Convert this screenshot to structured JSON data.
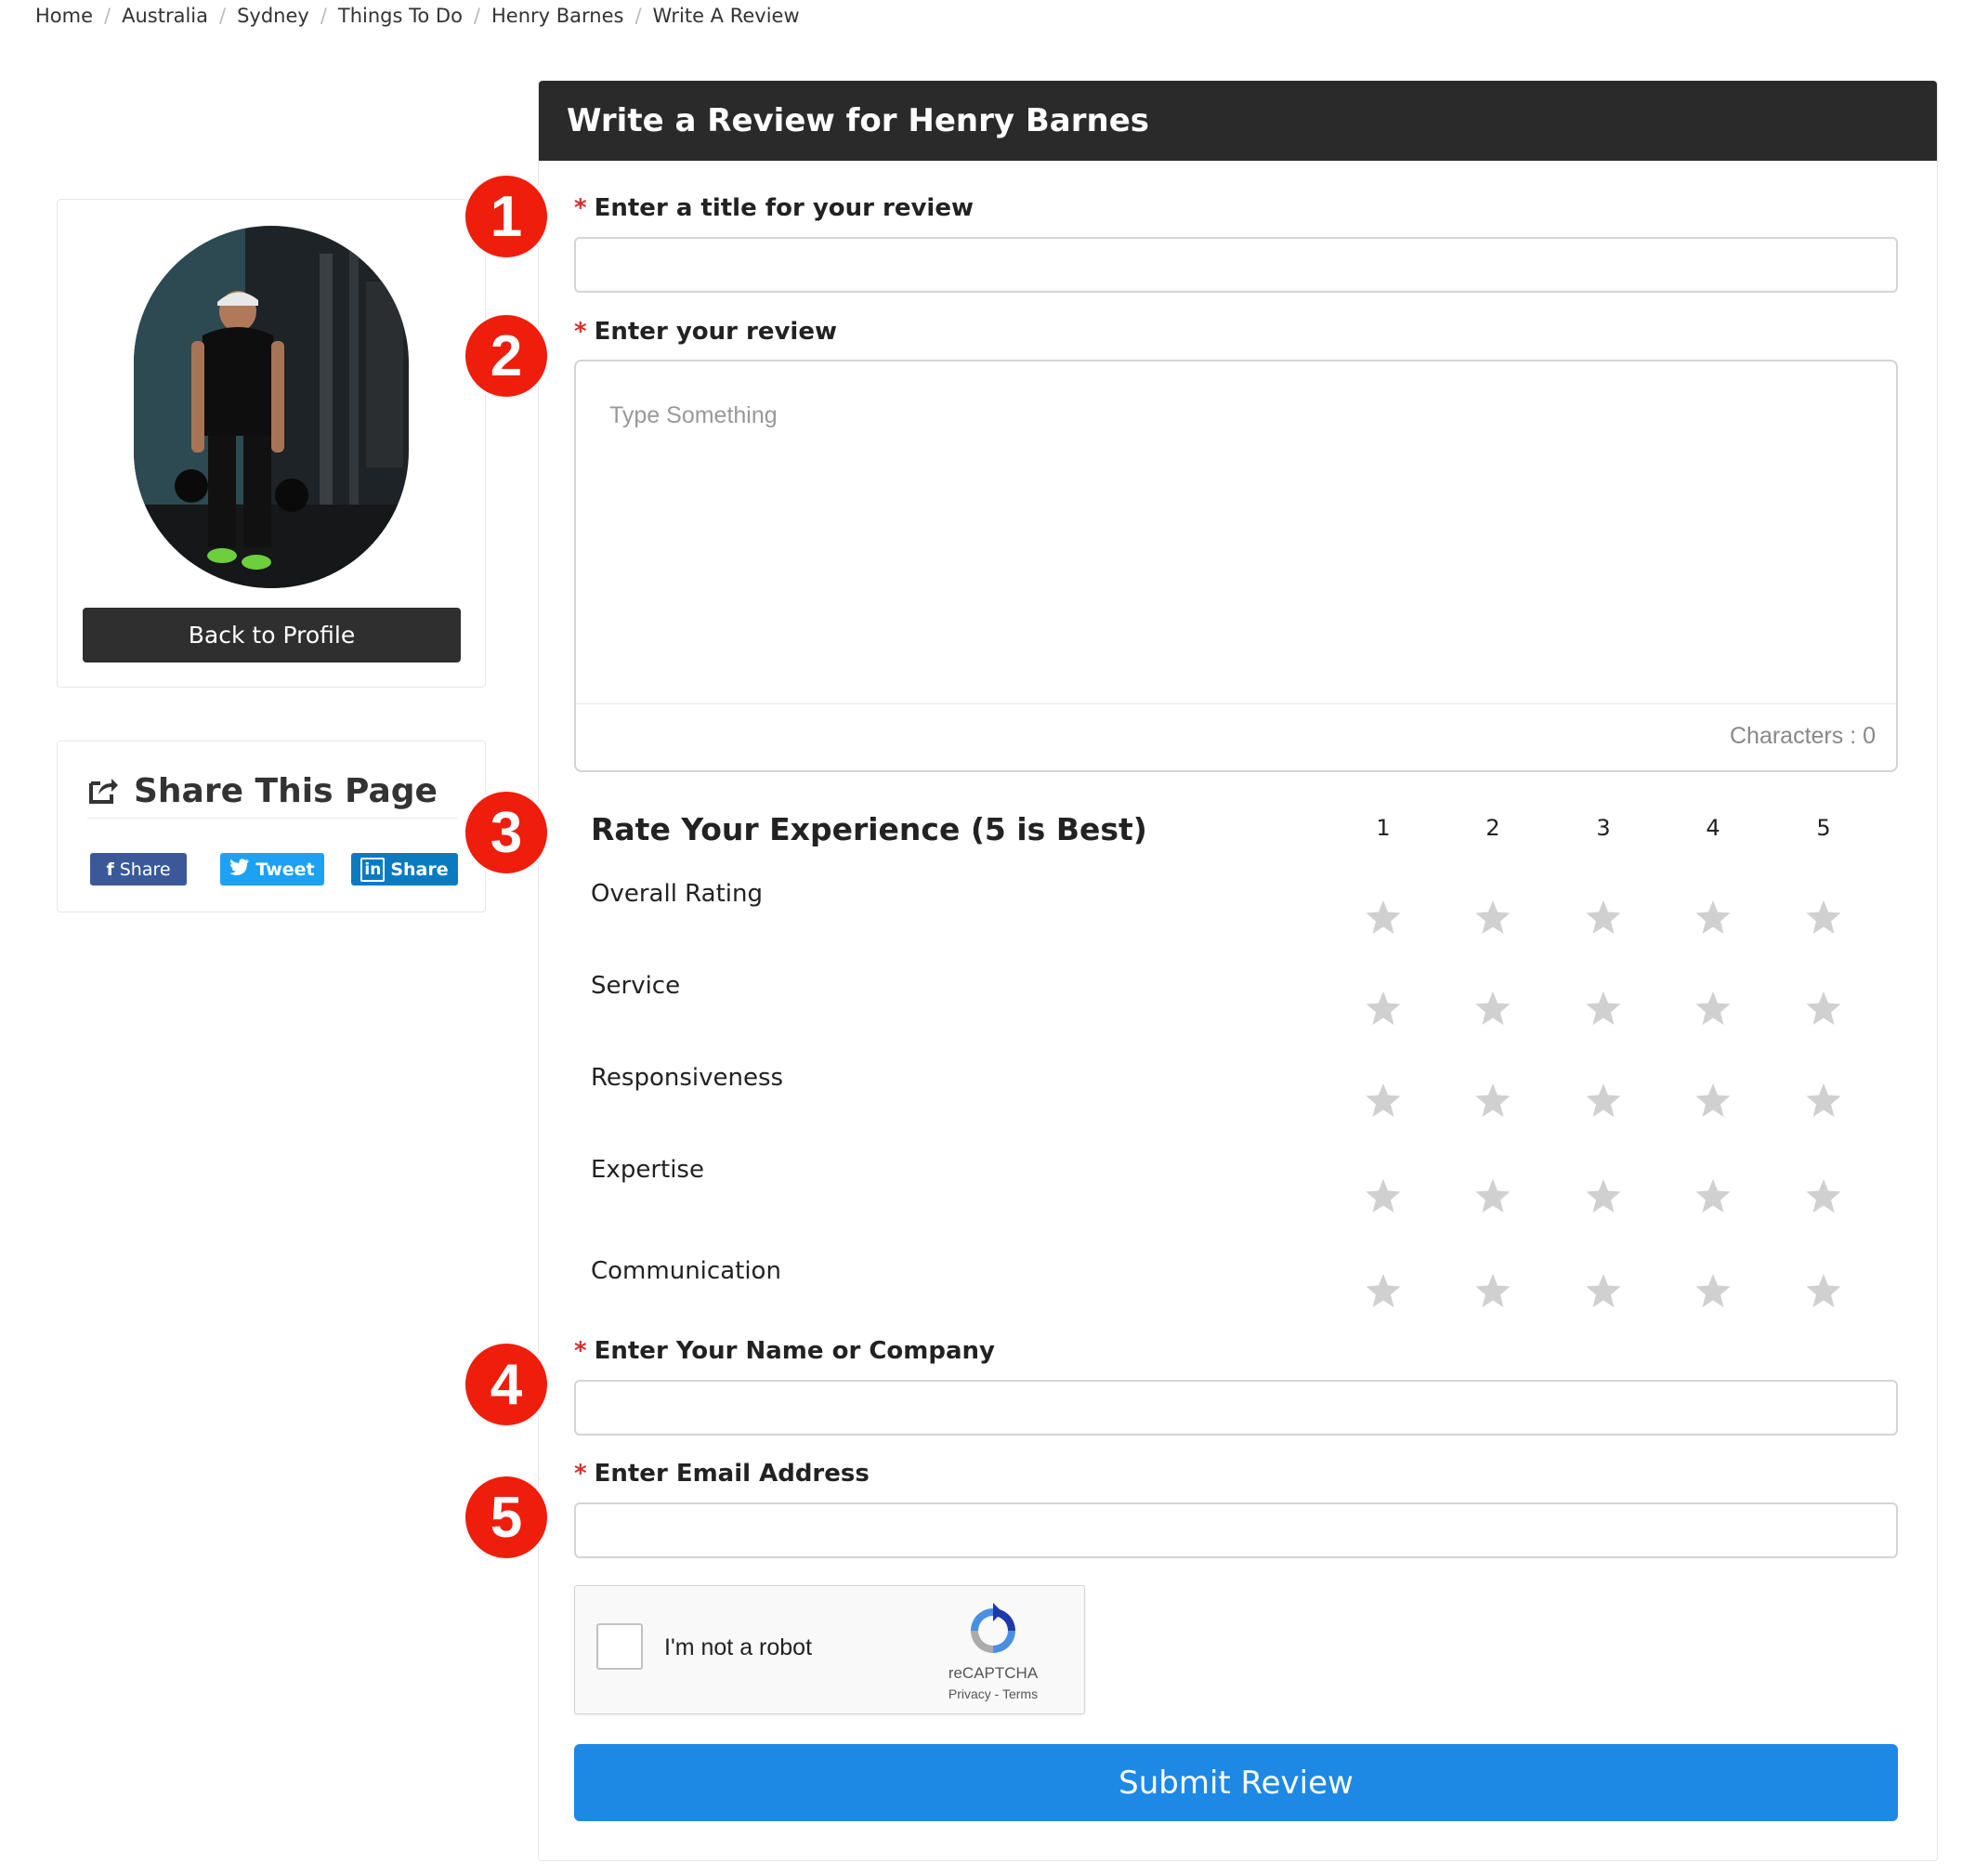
{
  "breadcrumb": [
    "Home",
    "Australia",
    "Sydney",
    "Things To Do",
    "Henry Barnes",
    "Write A Review"
  ],
  "sidebar": {
    "back_button": "Back to Profile",
    "share_title": "Share This Page",
    "share_buttons": {
      "facebook": "Share",
      "twitter": "Tweet",
      "linkedin": "Share"
    }
  },
  "markers": [
    "1",
    "2",
    "3",
    "4",
    "5"
  ],
  "form": {
    "header": "Write a Review for Henry Barnes",
    "required_mark": "*",
    "title_label": "Enter a title for your review",
    "title_value": "",
    "review_label": "Enter your review",
    "review_placeholder": "Type Something",
    "characters_text": "Characters : 0",
    "rating": {
      "title": "Rate Your Experience (5 is Best)",
      "columns": [
        "1",
        "2",
        "3",
        "4",
        "5"
      ],
      "rows": [
        "Overall Rating",
        "Service",
        "Responsiveness",
        "Expertise",
        "Communication"
      ],
      "star_color": "#d0d0d0"
    },
    "name_label": "Enter Your Name or Company",
    "name_value": "",
    "email_label": "Enter Email Address",
    "email_value": "",
    "captcha": {
      "label": "I'm not a robot",
      "brand": "reCAPTCHA",
      "links": "Privacy - Terms"
    },
    "submit_label": "Submit Review"
  },
  "colors": {
    "header_bg": "#2a2a2a",
    "submit_bg": "#1e88e5",
    "marker": "#ef1d0c",
    "required": "#d62e2e"
  }
}
